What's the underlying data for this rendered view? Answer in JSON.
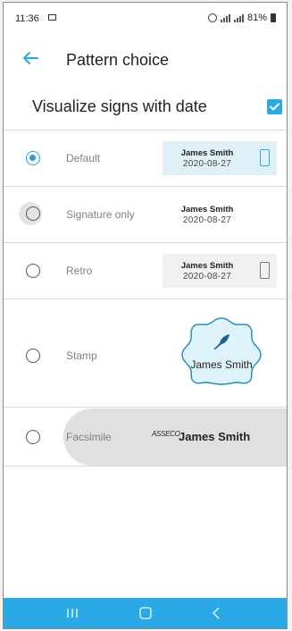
{
  "status_bar": {
    "time": "11:36",
    "battery": "81%"
  },
  "app_bar": {
    "title": "Pattern choice"
  },
  "visualize": {
    "label": "Visualize signs with date",
    "checked": true
  },
  "options": [
    {
      "label": "Default",
      "selected": true,
      "name": "James Smith",
      "date": "2020-08-27"
    },
    {
      "label": "Signature only",
      "selected": false,
      "name": "James Smith",
      "date": "2020-08-27"
    },
    {
      "label": "Retro",
      "selected": false,
      "name": "James Smith",
      "date": "2020-08-27"
    },
    {
      "label": "Stamp",
      "selected": false,
      "name": "James Smith"
    },
    {
      "label": "Facsimile",
      "selected": false,
      "name": "James Smith",
      "logo_text": "ASSECO"
    }
  ],
  "colors": {
    "accent": "#2aa9e6",
    "navbar": "#2aa9e6",
    "selected_preview_bg": "#dff0f6"
  },
  "nav_bar": {
    "items": [
      "recent-apps",
      "home",
      "back"
    ]
  }
}
